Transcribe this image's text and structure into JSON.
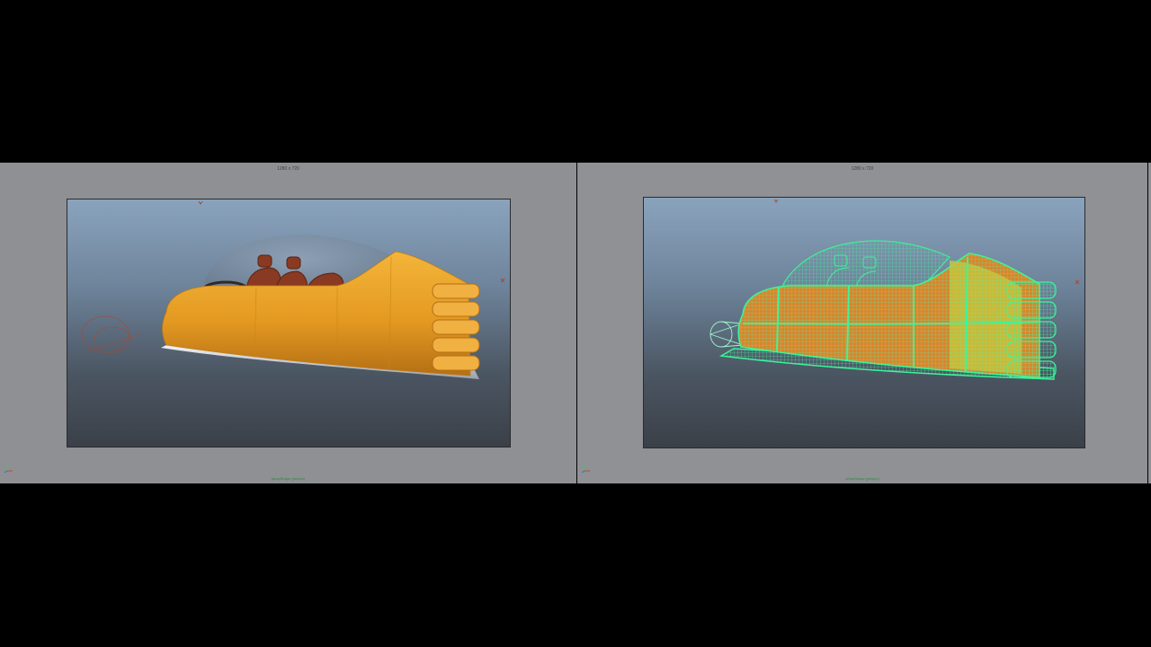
{
  "panels": {
    "left": {
      "resolution_label": "1280 x 720",
      "camera_label": "perspShape (persp1)",
      "view_mode": "smooth-shaded",
      "icons": {
        "axis": "axis-gizmo-icon",
        "camera": "camera-icon"
      }
    },
    "right": {
      "resolution_label": "1280 x 720",
      "camera_label": "perspShape (persp1)",
      "view_mode": "wireframe-on-shaded",
      "icons": {
        "axis": "axis-gizmo-icon",
        "camera": "camera-icon"
      }
    }
  },
  "colors": {
    "body_orange": "#e9a12a",
    "wire_green": "#3cf59a",
    "seat_brown": "#8a3a22",
    "skirt_silver": "#d8dde2",
    "panel_gray": "#8e9094"
  }
}
